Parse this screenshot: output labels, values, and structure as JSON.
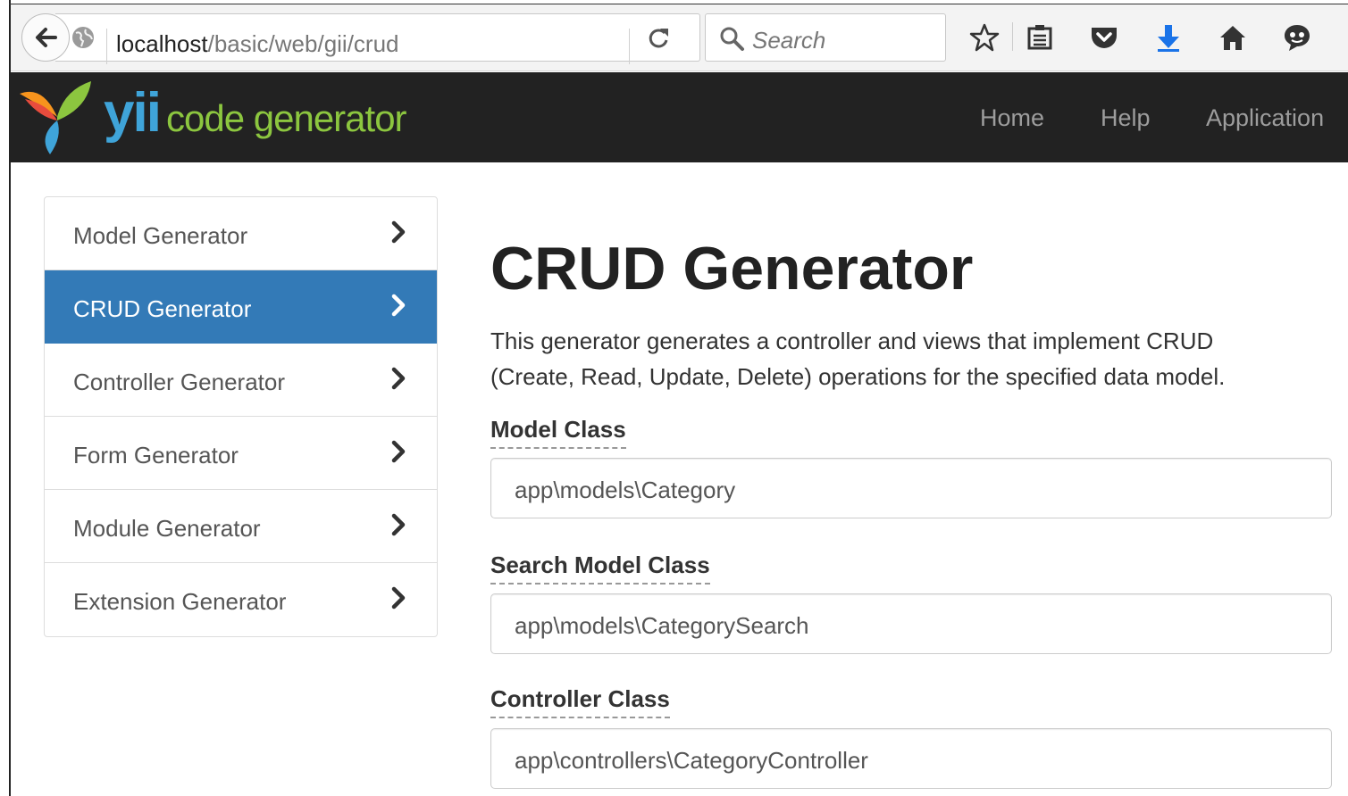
{
  "browser": {
    "url_host": "localhost",
    "url_path": "/basic/web/gii/crud",
    "search_placeholder": "Search",
    "icons": [
      "back-icon",
      "globe-icon",
      "reload-icon",
      "search-icon",
      "bookmark-star-icon",
      "reading-list-icon",
      "pocket-icon",
      "download-icon",
      "home-icon",
      "chat-icon"
    ],
    "download_color": "#1a73e8"
  },
  "navbar": {
    "brand_yii": "yii",
    "brand_rest": "code generator",
    "links": [
      "Home",
      "Help",
      "Application"
    ],
    "background": "#222222",
    "brand_colors": {
      "yii": "#3fa4d9",
      "code": "#8cc63f"
    }
  },
  "sidebar": {
    "items": [
      {
        "label": "Model Generator",
        "active": false
      },
      {
        "label": "CRUD Generator",
        "active": true
      },
      {
        "label": "Controller Generator",
        "active": false
      },
      {
        "label": "Form Generator",
        "active": false
      },
      {
        "label": "Module Generator",
        "active": false
      },
      {
        "label": "Extension Generator",
        "active": false
      }
    ],
    "active_color": "#337ab7"
  },
  "main": {
    "title": "CRUD Generator",
    "description_line1": "This generator generates a controller and views that implement CRUD",
    "description_line2": "(Create, Read, Update, Delete) operations for the specified data model.",
    "fields": [
      {
        "label": "Model Class",
        "value": "app\\models\\Category"
      },
      {
        "label": "Search Model Class",
        "value": "app\\models\\CategorySearch"
      },
      {
        "label": "Controller Class",
        "value": "app\\controllers\\CategoryController"
      }
    ]
  }
}
